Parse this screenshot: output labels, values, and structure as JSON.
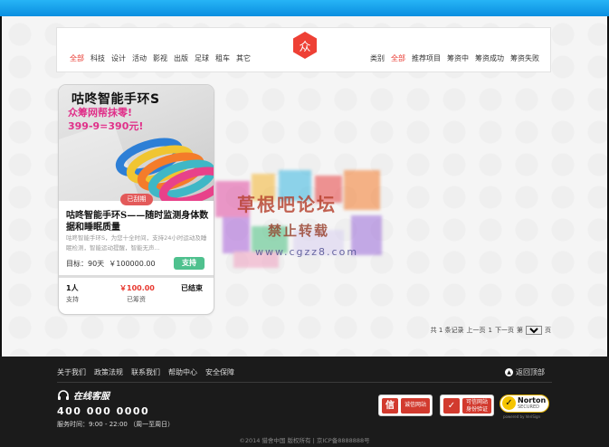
{
  "nav": {
    "categories": [
      "全部",
      "科技",
      "设计",
      "活动",
      "影视",
      "出版",
      "足球",
      "租车",
      "其它"
    ],
    "active_category": "全部",
    "logo_char": "众",
    "status_label": "类别",
    "statuses": [
      "全部",
      "推荐项目",
      "筹资中",
      "筹资成功",
      "筹资失败"
    ],
    "active_status": "全部"
  },
  "project": {
    "image_title": "咕咚智能手环S",
    "image_subtitle": "众筹网帮抹零!",
    "image_price": "399-9=390元!",
    "badge": "已刮期",
    "title": "咕咚智能手环S——随时监测身体数据和睡眠质量",
    "description": "咕咚智能手环S，为您十全时间，支持24小时运动及睡眠检测，智能运动提醒，智能无声...",
    "target_label": "目标：",
    "target_days": "90天",
    "target_amount": "￥100000.00",
    "support_label": "支持",
    "supporters_value": "1人",
    "supporters_label": "支持",
    "raised_value": "￥100.00",
    "raised_label": "已筹资",
    "status_value": "已结束",
    "band_colors": [
      "#2d7fd6",
      "#f0c531",
      "#f47c2a",
      "#3fb7c6",
      "#e8418a"
    ]
  },
  "pager": {
    "summary": "共 1 条记录",
    "prev": "上一页",
    "current": "1",
    "next": "下一页",
    "page_prefix": "第",
    "page_value": "1",
    "page_suffix": "页"
  },
  "watermark": {
    "title": "草根吧论坛",
    "subtitle": "禁止转载",
    "url": "www.cgzz8.com"
  },
  "footer": {
    "links": [
      "关于我们",
      "政策法规",
      "联系我们",
      "帮助中心",
      "安全保障"
    ],
    "back_to_top": "返回顶部",
    "service_title": "在线客服",
    "phone": "400 000 0000",
    "hours": "服务时间：9:00 - 22:00 （周一至周日）",
    "trust1_icon": "信",
    "trust1_label": "诚信网站",
    "trust2_label_a": "可信网站",
    "trust2_label_b": "身份验证",
    "norton_title": "Norton",
    "norton_sub": "SECURED",
    "norton_powered": "powered by VeriSign",
    "copyright": "©2014 猎舍中国 版权所有 | 京ICP备8888888号"
  },
  "colors": {
    "accent": "#e8382f",
    "topbar": "#1aa3ec",
    "support_button": "#4fc18e",
    "badge": "#e35a5a"
  }
}
